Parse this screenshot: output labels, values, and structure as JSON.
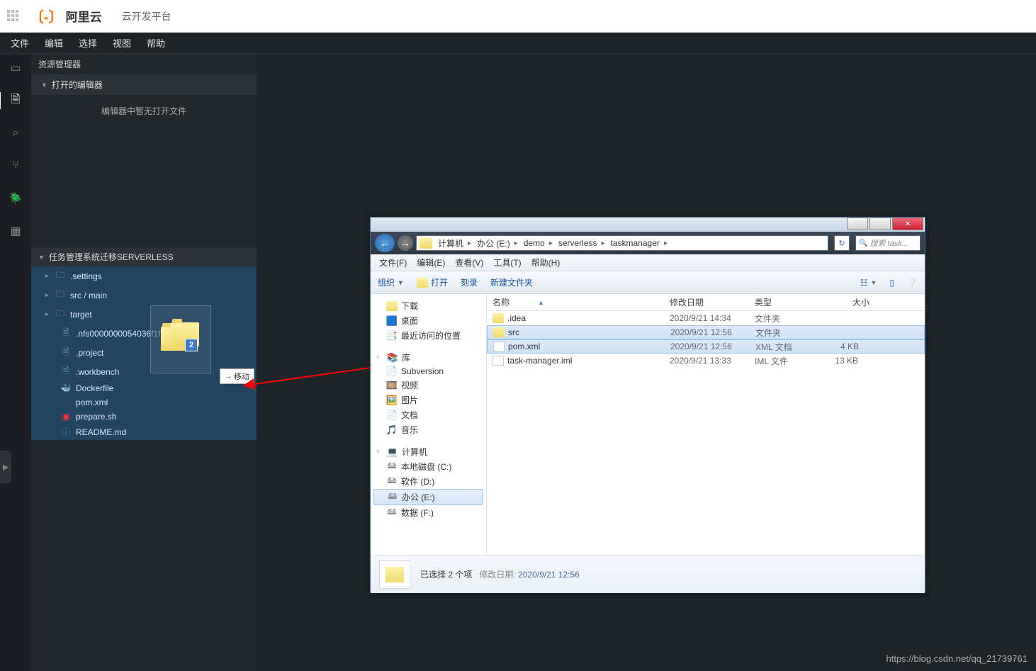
{
  "header": {
    "brand_cn": "阿里云",
    "platform": "云开发平台"
  },
  "menubar": [
    "文件",
    "编辑",
    "选择",
    "视图",
    "帮助"
  ],
  "sidebar": {
    "panel_title": "资源管理器",
    "open_editors_header": "打开的编辑器",
    "empty_msg": "编辑器中暂无打开文件",
    "project_name": "任务管理系统迁移SERVERLESS",
    "tree": [
      {
        "type": "folder",
        "name": ".settings"
      },
      {
        "type": "folder",
        "name": "src / main"
      },
      {
        "type": "folder",
        "name": "target"
      },
      {
        "type": "file",
        "name": ".nfs0000000054036f1f00000001",
        "icon": "file"
      },
      {
        "type": "file",
        "name": ".project",
        "icon": "file"
      },
      {
        "type": "file",
        "name": ".workbench",
        "icon": "file"
      },
      {
        "type": "file",
        "name": "Dockerfile",
        "icon": "docker"
      },
      {
        "type": "file",
        "name": "pom.xml",
        "icon": "xml"
      },
      {
        "type": "file",
        "name": "prepare.sh",
        "icon": "sh"
      },
      {
        "type": "file",
        "name": "README.md",
        "icon": "md"
      }
    ]
  },
  "drag": {
    "badge": "2",
    "tip": "移动"
  },
  "explorer": {
    "breadcrumb": [
      "计算机",
      "办公 (E:)",
      "demo",
      "serverless",
      "taskmanager"
    ],
    "search_placeholder": "搜索 task...",
    "menu": [
      "文件(F)",
      "编辑(E)",
      "查看(V)",
      "工具(T)",
      "帮助(H)"
    ],
    "toolbar": {
      "organize": "组织",
      "open": "打开",
      "burn": "刻录",
      "newfolder": "新建文件夹"
    },
    "tree": {
      "downloads": "下载",
      "desktop": "桌面",
      "recent": "最近访问的位置",
      "library": "库",
      "subversion": "Subversion",
      "video": "视频",
      "pictures": "图片",
      "docs": "文档",
      "music": "音乐",
      "computer": "计算机",
      "drive_c": "本地磁盘 (C:)",
      "drive_d": "软件 (D:)",
      "drive_e": "办公 (E:)",
      "drive_f": "数据 (F:)"
    },
    "columns": {
      "name": "名称",
      "date": "修改日期",
      "type": "类型",
      "size": "大小"
    },
    "rows": [
      {
        "name": ".idea",
        "date": "2020/9/21 14:34",
        "type": "文件夹",
        "size": "",
        "kind": "folder",
        "selected": false
      },
      {
        "name": "src",
        "date": "2020/9/21 12:56",
        "type": "文件夹",
        "size": "",
        "kind": "folder",
        "selected": true
      },
      {
        "name": "pom.xml",
        "date": "2020/9/21 12:56",
        "type": "XML 文档",
        "size": "4 KB",
        "kind": "file",
        "selected": true
      },
      {
        "name": "task-manager.iml",
        "date": "2020/9/21 13:33",
        "type": "IML 文件",
        "size": "13 KB",
        "kind": "file",
        "selected": false
      }
    ],
    "status": {
      "selection": "已选择 2 个项",
      "date_label": "修改日期:",
      "date_value": "2020/9/21 12:56"
    }
  },
  "watermark": "https://blog.csdn.net/qq_21739761"
}
